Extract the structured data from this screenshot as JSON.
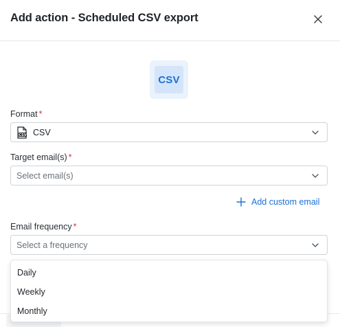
{
  "dialog": {
    "title": "Add action - Scheduled CSV export"
  },
  "logo": {
    "text": "CSV",
    "icon": "csv-logo"
  },
  "format": {
    "label": "Format",
    "required": "*",
    "value": "CSV",
    "icon": "csv-file-icon"
  },
  "target_emails": {
    "label": "Target email(s)",
    "required": "*",
    "placeholder": "Select email(s)"
  },
  "add_custom_email": {
    "label": "Add custom email",
    "icon": "plus-icon"
  },
  "email_frequency": {
    "label": "Email frequency",
    "required": "*",
    "placeholder": "Select a frequency",
    "options": [
      "Daily",
      "Weekly",
      "Monthly"
    ]
  },
  "colors": {
    "accent": "#1a6fd6",
    "required": "#d92d3a",
    "border": "#cfd3d8"
  }
}
